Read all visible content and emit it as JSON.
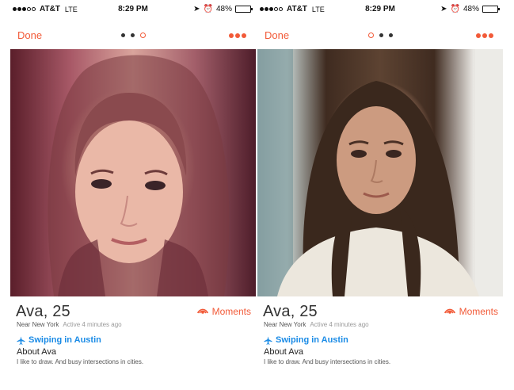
{
  "screens": [
    {
      "status": {
        "carrier": "AT&T",
        "network": "LTE",
        "time": "8:29 PM",
        "battery": "48%",
        "battery_level": 0.48
      },
      "nav": {
        "done_label": "Done",
        "pager_count": 3,
        "pager_active": 2
      },
      "profile": {
        "name": "Ava, 25",
        "location": "Near New York",
        "active": "Active 4 minutes ago",
        "moments_label": "Moments",
        "swiping": "Swiping in Austin",
        "about_title": "About Ava",
        "about_text": "I like to draw. And busy intersections in cities."
      }
    },
    {
      "status": {
        "carrier": "AT&T",
        "network": "LTE",
        "time": "8:29 PM",
        "battery": "48%",
        "battery_level": 0.48
      },
      "nav": {
        "done_label": "Done",
        "pager_count": 3,
        "pager_active": 0
      },
      "profile": {
        "name": "Ava, 25",
        "location": "Near New York",
        "active": "Active 4 minutes ago",
        "moments_label": "Moments",
        "swiping": "Swiping in Austin",
        "about_title": "About Ava",
        "about_text": "I like to draw. And busy intersections in cities."
      }
    }
  ],
  "colors": {
    "accent": "#f25a38",
    "link": "#1a8be6"
  },
  "icons": {
    "moments": "broadcast-icon",
    "swiping": "airplane-icon",
    "more": "more-dots-icon"
  }
}
